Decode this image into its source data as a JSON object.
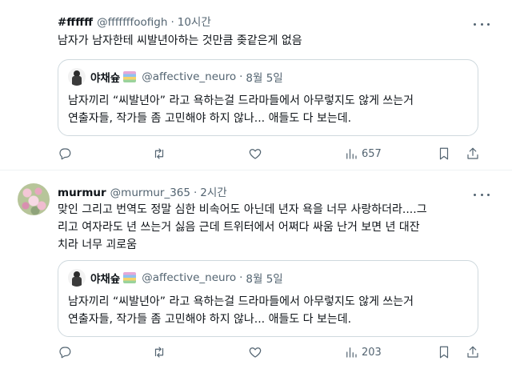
{
  "tweets": [
    {
      "name": "#ffffff",
      "handle": "@fffffffoofigh",
      "dot": "·",
      "time": "10시간",
      "text_lines": [
        "남자가 남자한테 씨발년아하는 것만큼 좆같은게 없음"
      ],
      "quote": {
        "name": "야채슢",
        "handle": "@affective_neuro",
        "dot": "·",
        "time": "8월 5일",
        "text_lines": [
          "남자끼리 “씨발년아” 라고 욕하는걸 드라마들에서 아무렇지도 않게 쓰는거",
          "연출자들, 작가들 좀 고민해야 하지 않나... 애들도 다 보는데."
        ]
      },
      "views": "657"
    },
    {
      "name": "murmur",
      "handle": "@murmur_365",
      "dot": "·",
      "time": "2시간",
      "text_lines": [
        "맞인 그리고 번역도 정말 심한 비속어도 아닌데 년자 욕을 너무 사랑하더라....그",
        "리고 여자라도 년 쓰는거 싫음 근데 트위터에서 어쩌다 싸움 난거 보면 년 대잔",
        "치라 너무 괴로움"
      ],
      "quote": {
        "name": "야채슢",
        "handle": "@affective_neuro",
        "dot": "·",
        "time": "8월 5일",
        "text_lines": [
          "남자끼리 “씨발년아” 라고 욕하는걸 드라마들에서 아무렇지도 않게 쓰는거",
          "연출자들, 작가들 좀 고민해야 하지 않나... 애들도 다 보는데."
        ]
      },
      "views": "203"
    }
  ],
  "icons": {
    "reply": "reply-icon",
    "retweet": "retweet-icon",
    "like": "heart-icon",
    "views": "views-icon",
    "bookmark": "bookmark-icon",
    "share": "share-icon",
    "more": "more-icon"
  },
  "colors": {
    "text": "#0f1419",
    "secondary": "#536471",
    "border": "#cfd9de"
  }
}
